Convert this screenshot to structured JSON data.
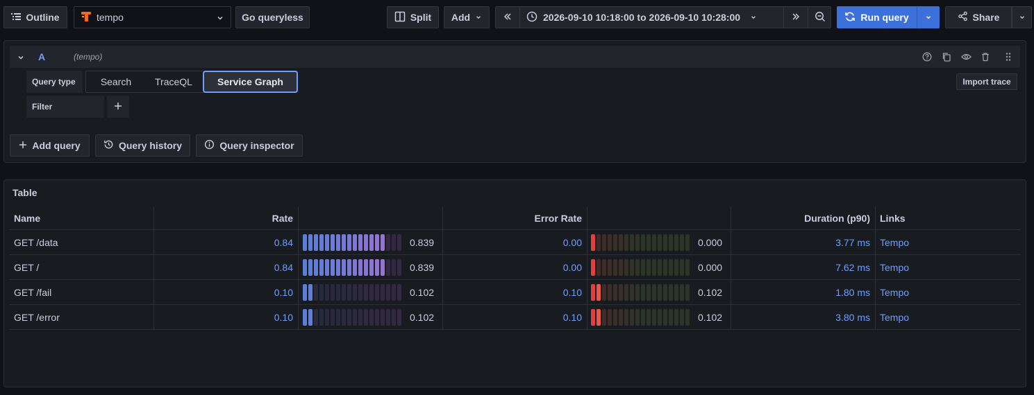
{
  "toolbar": {
    "outline_label": "Outline",
    "datasource_name": "tempo",
    "queryless_label": "Go queryless",
    "split_label": "Split",
    "add_label": "Add",
    "time_range": "2026-09-10 10:18:00 to 2026-09-10 10:28:00",
    "run_query_label": "Run query",
    "share_label": "Share"
  },
  "query": {
    "ref_id": "A",
    "datasource": "(tempo)",
    "query_type_label": "Query type",
    "query_types": [
      "Search",
      "TraceQL",
      "Service Graph"
    ],
    "selected_query_type": "Service Graph",
    "filter_label": "Filter",
    "import_trace_label": "Import trace"
  },
  "actions": {
    "add_query": "Add query",
    "query_history": "Query history",
    "query_inspector": "Query inspector"
  },
  "table": {
    "title": "Table",
    "headers": {
      "name": "Name",
      "rate": "Rate",
      "error_rate": "Error Rate",
      "duration": "Duration (p90)",
      "links": "Links"
    },
    "rows": [
      {
        "name": "GET /data",
        "rate": "0.84",
        "rate_gauge": "0.839",
        "rate_fraction": 0.839,
        "error_rate": "0.00",
        "error_gauge": "0.000",
        "error_fraction": 0.0,
        "duration": "3.77 ms",
        "link": "Tempo"
      },
      {
        "name": "GET /",
        "rate": "0.84",
        "rate_gauge": "0.839",
        "rate_fraction": 0.839,
        "error_rate": "0.00",
        "error_gauge": "0.000",
        "error_fraction": 0.0,
        "duration": "7.62 ms",
        "link": "Tempo"
      },
      {
        "name": "GET /fail",
        "rate": "0.10",
        "rate_gauge": "0.102",
        "rate_fraction": 0.102,
        "error_rate": "0.10",
        "error_gauge": "0.102",
        "error_fraction": 0.102,
        "duration": "1.80 ms",
        "link": "Tempo"
      },
      {
        "name": "GET /error",
        "rate": "0.10",
        "rate_gauge": "0.102",
        "rate_fraction": 0.102,
        "error_rate": "0.10",
        "error_gauge": "0.102",
        "error_fraction": 0.102,
        "duration": "3.80 ms",
        "link": "Tempo"
      }
    ]
  },
  "colors": {
    "accent": "#6e9fff",
    "primary_button": "#3d71d9",
    "rate_gauge_start": "#5b7fd6",
    "rate_gauge_end": "#a070d0",
    "error_gauge_start": "#e0403f",
    "error_gauge_end": "#f08050"
  },
  "icons": {
    "outline": "list-icon",
    "datasource": "tempo-logo-icon",
    "split": "columns-icon",
    "time": "clock-icon",
    "run": "sync-icon",
    "share": "share-icon"
  }
}
